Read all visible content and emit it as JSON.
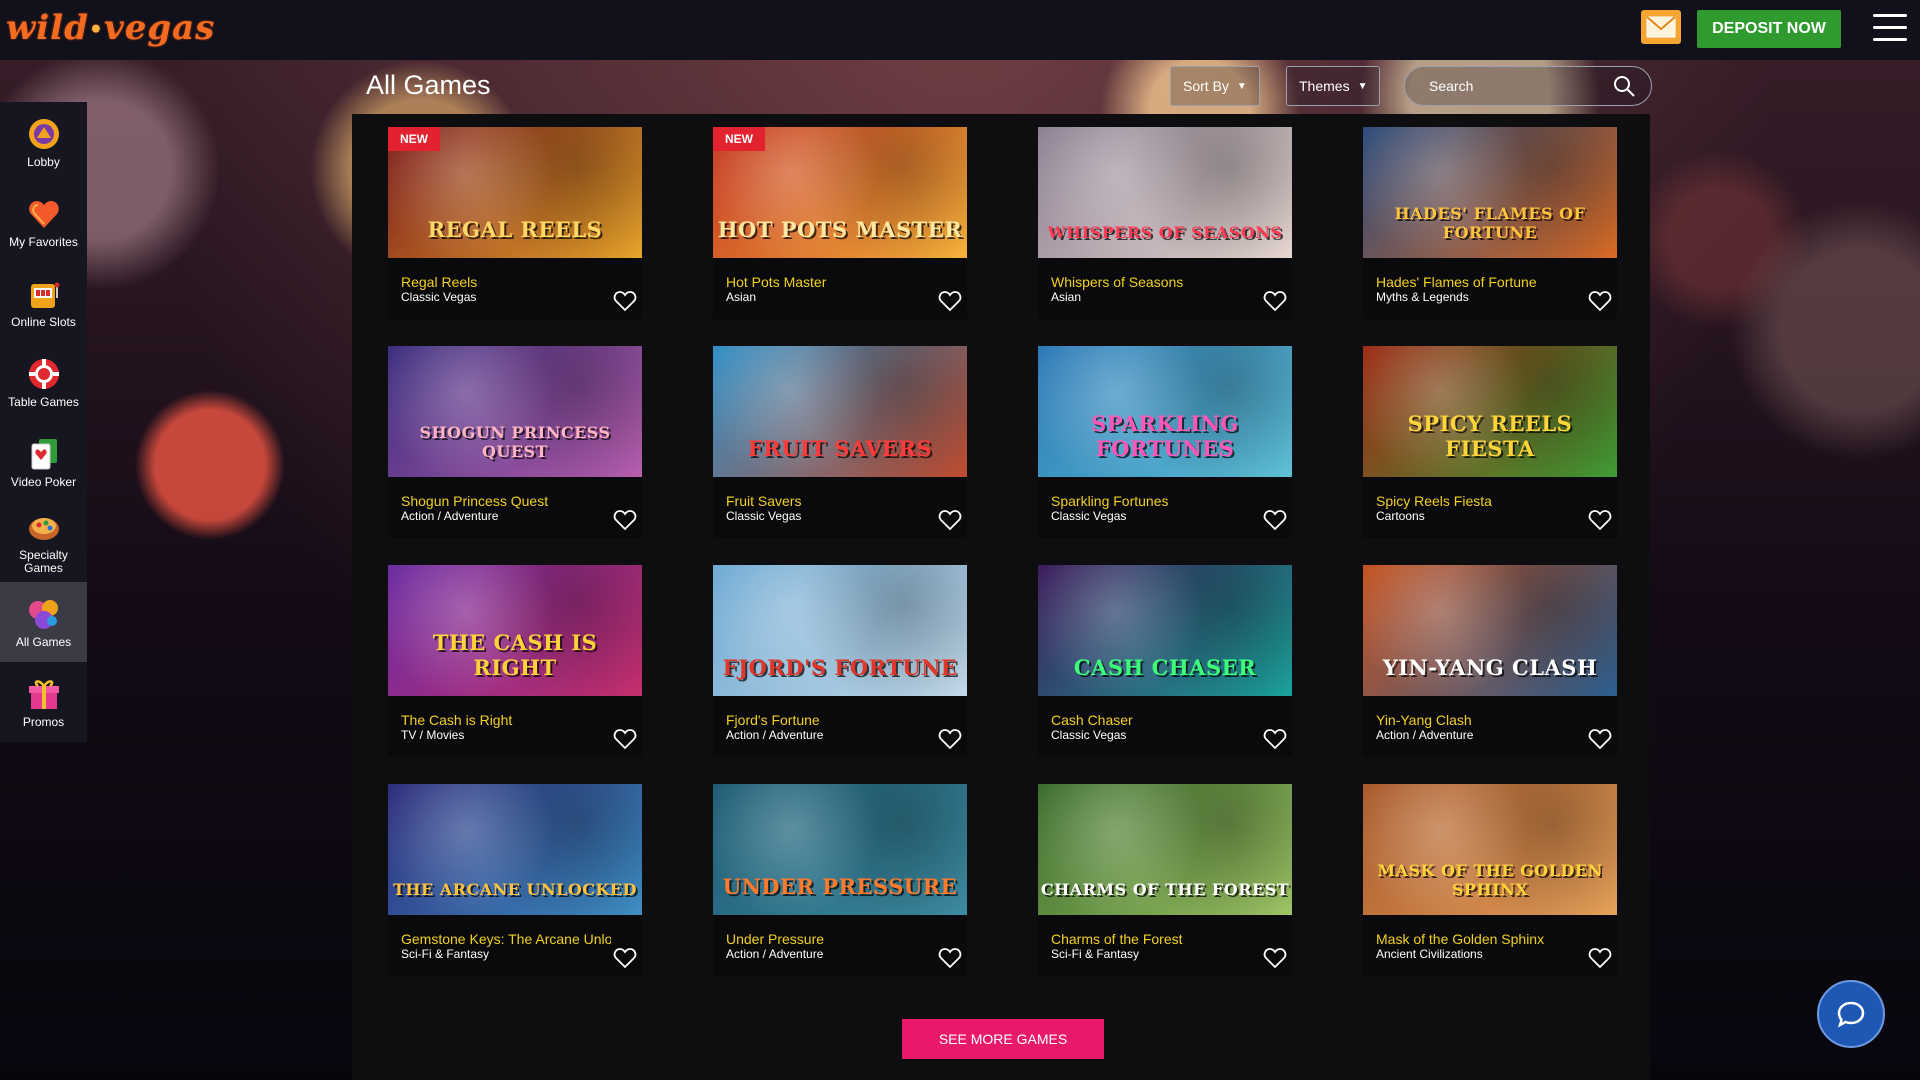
{
  "header": {
    "logo_left": "wild",
    "logo_dot": "•",
    "logo_right": "vegas",
    "deposit_label": "DEPOSIT NOW",
    "mail_icon": "envelope-icon",
    "menu_icon": "hamburger-icon"
  },
  "sidebar": {
    "items": [
      {
        "label": "Lobby",
        "icon": "lobby-icon"
      },
      {
        "label": "My Favorites",
        "icon": "heart-icon"
      },
      {
        "label": "Online Slots",
        "icon": "slot-machine-icon"
      },
      {
        "label": "Table Games",
        "icon": "casino-chip-icon"
      },
      {
        "label": "Video Poker",
        "icon": "playing-card-icon"
      },
      {
        "label": "Specialty Games",
        "icon": "specialty-games-icon"
      },
      {
        "label": "All Games",
        "icon": "all-games-icon",
        "active": true
      },
      {
        "label": "Promos",
        "icon": "gift-icon"
      }
    ]
  },
  "toolbar": {
    "title": "All Games",
    "sort_label": "Sort By",
    "themes_label": "Themes",
    "search_placeholder": "Search"
  },
  "games": [
    {
      "name": "Regal Reels",
      "category": "Classic Vegas",
      "badge": "NEW",
      "art_title": "REGAL REELS",
      "colors": [
        "#7a1a1a",
        "#e8a52a"
      ],
      "title_color": "#ffd766"
    },
    {
      "name": "Hot Pots Master",
      "category": "Asian",
      "badge": "NEW",
      "art_title": "HOT POTS MASTER",
      "colors": [
        "#c2341f",
        "#f7b33b"
      ],
      "title_color": "#ffe7a0"
    },
    {
      "name": "Whispers of Seasons",
      "category": "Asian",
      "badge": "",
      "art_title": "WHISPERS OF SEASONS",
      "colors": [
        "#8c7f92",
        "#e6d7d0"
      ],
      "title_color": "#ff3a55"
    },
    {
      "name": "Hades' Flames of Fortune",
      "category": "Myths & Legends",
      "badge": "",
      "art_title": "HADES' FLAMES OF FORTUNE",
      "colors": [
        "#2b4a7a",
        "#d96a24"
      ],
      "title_color": "#ffc23d"
    },
    {
      "name": "Shogun Princess Quest",
      "category": "Action / Adventure",
      "badge": "",
      "art_title": "SHOGUN PRINCESS QUEST",
      "colors": [
        "#3a2c7c",
        "#b85fae"
      ],
      "title_color": "#ffb4c2"
    },
    {
      "name": "Fruit Savers",
      "category": "Classic Vegas",
      "badge": "",
      "art_title": "FRUIT SAVERS",
      "colors": [
        "#2f8fc6",
        "#c04b2e"
      ],
      "title_color": "#ff3a3a"
    },
    {
      "name": "Sparkling Fortunes",
      "category": "Classic Vegas",
      "badge": "",
      "art_title": "SPARKLING FORTUNES",
      "colors": [
        "#2b78b6",
        "#5fc1d6"
      ],
      "title_color": "#ff56b8"
    },
    {
      "name": "Spicy Reels Fiesta",
      "category": "Cartoons",
      "badge": "",
      "art_title": "SPICY REELS FIESTA",
      "colors": [
        "#9c2a14",
        "#3d9c34"
      ],
      "title_color": "#ffd33a"
    },
    {
      "name": "The Cash is Right",
      "category": "TV / Movies",
      "badge": "",
      "art_title": "THE CASH IS RIGHT",
      "colors": [
        "#6a2aa0",
        "#c62f6c"
      ],
      "title_color": "#ffd23a"
    },
    {
      "name": "Fjord's Fortune",
      "category": "Action / Adventure",
      "badge": "",
      "art_title": "FJORD'S FORTUNE",
      "colors": [
        "#6ea9d2",
        "#c2d8e8"
      ],
      "title_color": "#e0372a"
    },
    {
      "name": "Cash Chaser",
      "category": "Classic Vegas",
      "badge": "",
      "art_title": "CASH CHASER",
      "colors": [
        "#3b1a5a",
        "#1aa39a"
      ],
      "title_color": "#3dff7a"
    },
    {
      "name": "Yin-Yang Clash",
      "category": "Action / Adventure",
      "badge": "",
      "art_title": "YIN-YANG CLASH",
      "colors": [
        "#c4511f",
        "#2c5e8f"
      ],
      "title_color": "#ffffff"
    },
    {
      "name": "Gemstone Keys: The Arcane Unlocked",
      "category": "Sci-Fi & Fantasy",
      "badge": "",
      "art_title": "THE ARCANE UNLOCKED",
      "colors": [
        "#2b2b7a",
        "#3e8fc4"
      ],
      "title_color": "#ffc23d"
    },
    {
      "name": "Under Pressure",
      "category": "Action / Adventure",
      "badge": "",
      "art_title": "UNDER PRESSURE",
      "colors": [
        "#1d5a72",
        "#3d8ba1"
      ],
      "title_color": "#ff7a2a"
    },
    {
      "name": "Charms of the Forest",
      "category": "Sci-Fi & Fantasy",
      "badge": "",
      "art_title": "CHARMS OF THE FOREST",
      "colors": [
        "#3a6b2a",
        "#9fc466"
      ],
      "title_color": "#ffffff"
    },
    {
      "name": "Mask of the Golden Sphinx",
      "category": "Ancient Civilizations",
      "badge": "",
      "art_title": "MASK OF THE GOLDEN SPHINX",
      "colors": [
        "#a8582a",
        "#e6a15a"
      ],
      "title_color": "#ffd23a"
    }
  ],
  "see_more_label": "SEE MORE GAMES",
  "chat_icon": "chat-bubble-icon"
}
